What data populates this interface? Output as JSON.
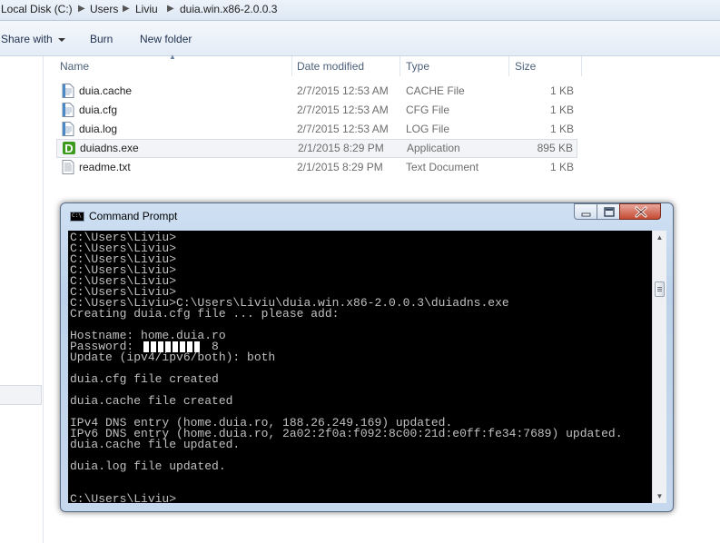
{
  "explorer": {
    "breadcrumb": [
      "Local Disk (C:)",
      "Users",
      "Liviu",
      "duia.win.x86-2.0.0.3"
    ],
    "toolbar": {
      "share_with": "Share with",
      "burn": "Burn",
      "new_folder": "New folder"
    },
    "columns": {
      "name": "Name",
      "date": "Date modified",
      "type": "Type",
      "size": "Size"
    },
    "files": [
      {
        "name": "duia.cache",
        "date": "2/7/2015 12:53 AM",
        "type": "CACHE File",
        "size": "1 KB",
        "icon": "text-file-icon"
      },
      {
        "name": "duia.cfg",
        "date": "2/7/2015 12:53 AM",
        "type": "CFG File",
        "size": "1 KB",
        "icon": "text-file-icon"
      },
      {
        "name": "duia.log",
        "date": "2/7/2015 12:53 AM",
        "type": "LOG File",
        "size": "1 KB",
        "icon": "text-file-icon"
      },
      {
        "name": "duiadns.exe",
        "date": "2/1/2015 8:29 PM",
        "type": "Application",
        "size": "895 KB",
        "icon": "duia-app-icon",
        "selected": true
      },
      {
        "name": "readme.txt",
        "date": "2/1/2015 8:29 PM",
        "type": "Text Document",
        "size": "1 KB",
        "icon": "text-document-icon"
      }
    ]
  },
  "cmd": {
    "title": "Command Prompt",
    "lines": [
      "C:\\Users\\Liviu>",
      "C:\\Users\\Liviu>",
      "C:\\Users\\Liviu>",
      "C:\\Users\\Liviu>",
      "C:\\Users\\Liviu>",
      "C:\\Users\\Liviu>",
      "C:\\Users\\Liviu>C:\\Users\\Liviu\\duia.win.x86-2.0.0.3\\duiadns.exe",
      "Creating duia.cfg file ... please add:",
      "",
      "Hostname: home.duia.ro",
      "Password:           8",
      "Update (ipv4/ipv6/both): both",
      "",
      "duia.cfg file created",
      "",
      "duia.cache file created",
      "",
      "IPv4 DNS entry (home.duia.ro, 188.26.249.169) updated.",
      "IPv6 DNS entry (home.duia.ro, 2a02:2f0a:f092:8c00:21d:e0ff:fe34:7689) updated.",
      "duia.cache file updated.",
      "",
      "duia.log file updated.",
      "",
      "",
      "C:\\Users\\Liviu>"
    ]
  },
  "colors": {
    "console_bg": "#000000",
    "console_text": "#c0c0c0",
    "selection": "#f2f4f7",
    "close_button": "#c44a33"
  }
}
